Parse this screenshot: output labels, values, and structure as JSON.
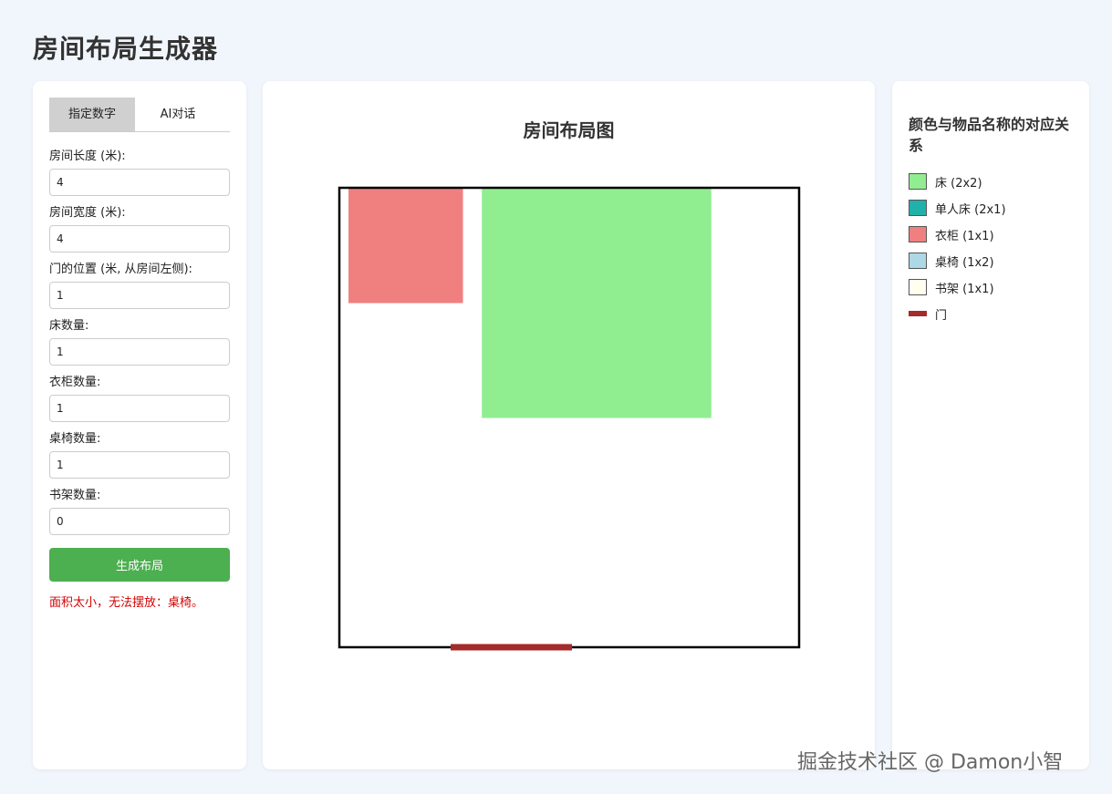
{
  "page_title": "房间布局生成器",
  "tabs": [
    {
      "label": "指定数字",
      "active": true
    },
    {
      "label": "AI对话",
      "active": false
    }
  ],
  "form": {
    "fields": [
      {
        "label": "房间长度 (米):",
        "value": "4"
      },
      {
        "label": "房间宽度 (米):",
        "value": "4"
      },
      {
        "label": "门的位置 (米, 从房间左侧):",
        "value": "1"
      },
      {
        "label": "床数量:",
        "value": "1"
      },
      {
        "label": "衣柜数量:",
        "value": "1"
      },
      {
        "label": "桌椅数量:",
        "value": "1"
      },
      {
        "label": "书架数量:",
        "value": "0"
      }
    ],
    "generate_label": "生成布局",
    "error_message": "面积太小，无法摆放：桌椅。"
  },
  "layout": {
    "title": "房间布局图",
    "room": {
      "length_m": 4,
      "width_m": 4
    },
    "door": {
      "position_m": 1,
      "width_m": 1
    },
    "items": [
      {
        "type": "wardrobe",
        "x_m": 0.04,
        "y_m": 0,
        "w_m": 1,
        "h_m": 1
      },
      {
        "type": "bed",
        "x_m": 1.2,
        "y_m": 0,
        "w_m": 2,
        "h_m": 2
      }
    ]
  },
  "legend": {
    "title": "颜色与物品名称的对应关系",
    "items": [
      {
        "key": "bed",
        "label": "床 (2x2)",
        "color": "#90ee90"
      },
      {
        "key": "single-bed",
        "label": "单人床 (2x1)",
        "color": "#20b2aa"
      },
      {
        "key": "wardrobe",
        "label": "衣柜 (1x1)",
        "color": "#f08080"
      },
      {
        "key": "desk",
        "label": "桌椅 (1x2)",
        "color": "#add8e6"
      },
      {
        "key": "bookshelf",
        "label": "书架 (1x1)",
        "color": "#fffff0"
      },
      {
        "key": "door",
        "label": "门",
        "color": "#a52a2a"
      }
    ]
  },
  "watermark": "掘金技术社区 @ Damon小智"
}
